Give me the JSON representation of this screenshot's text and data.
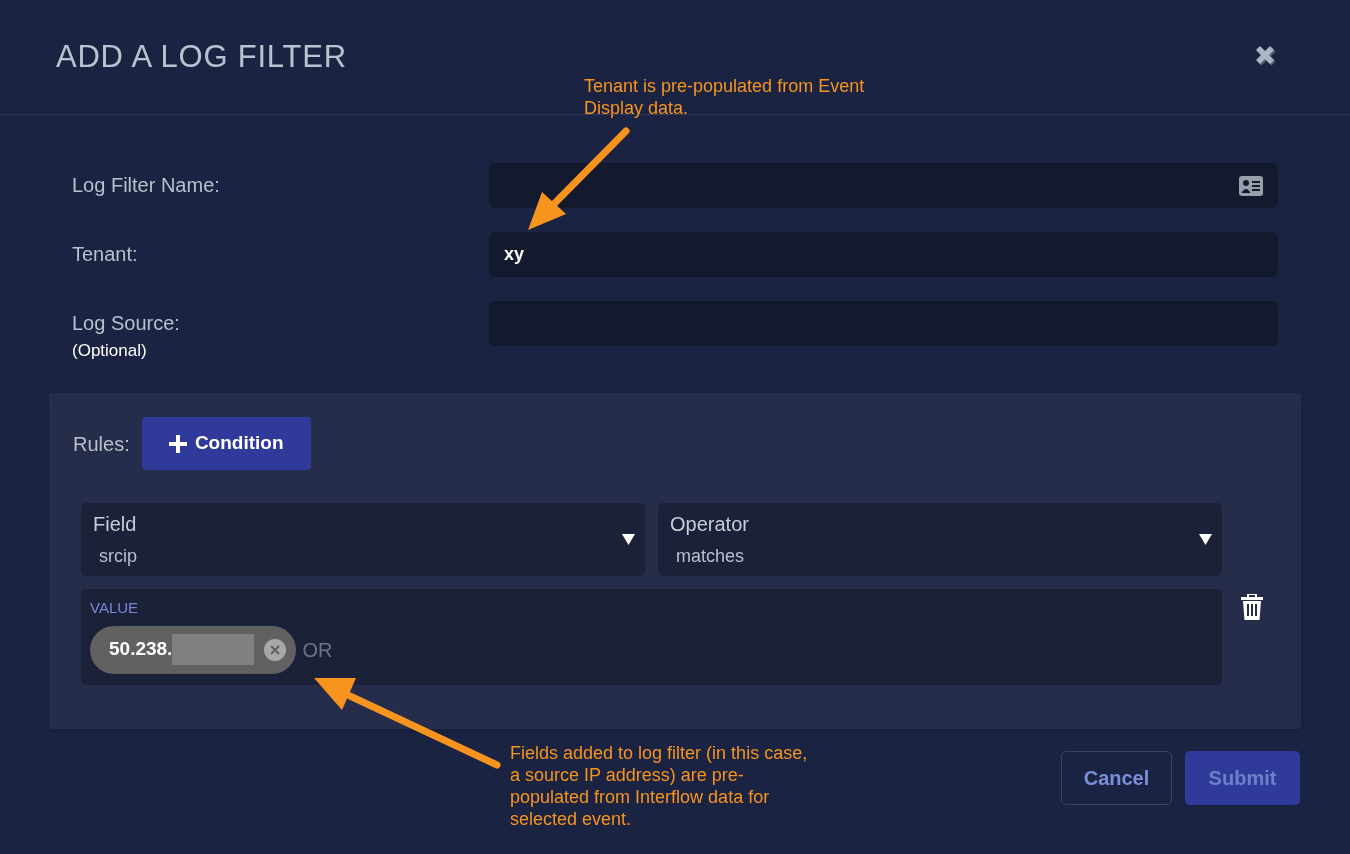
{
  "dialog": {
    "title": "ADD A LOG FILTER"
  },
  "fields": [
    {
      "label": "Log Filter Name:",
      "kind": "card"
    },
    {
      "label": "Tenant:",
      "value": "xy",
      "kind": "plain"
    },
    {
      "label": "Log Source:",
      "hint": "(Optional)",
      "kind": "plain"
    }
  ],
  "rules": {
    "label": "Rules:",
    "add_button": "Condition",
    "selects": [
      {
        "label": "Field",
        "value": "srcip"
      },
      {
        "label": "Operator",
        "value": "matches"
      }
    ],
    "value_box": {
      "label": "VALUE",
      "chips": [
        {
          "text": "50.238.",
          "redacted": true
        }
      ],
      "separator": "OR"
    }
  },
  "buttons": [
    {
      "label": "Cancel",
      "kind": "secondary",
      "disabled": false
    },
    {
      "label": "Submit",
      "kind": "primary",
      "disabled": true
    }
  ],
  "annotations": [
    {
      "text": "Tenant is pre-populated from Event Display data.",
      "kind": "top"
    },
    {
      "text": "Fields added to log filter (in this case, a source IP address) are pre-populated from Interflow data for selected event.",
      "kind": "bottom"
    }
  ]
}
